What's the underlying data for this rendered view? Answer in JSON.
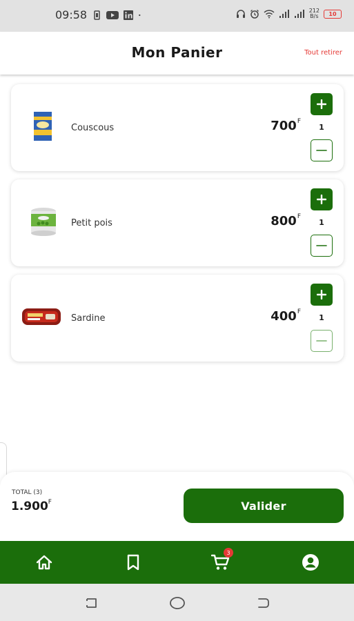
{
  "status_bar": {
    "time": "09:58",
    "net_speed_value": "212",
    "net_speed_unit": "B/s",
    "battery": "10"
  },
  "header": {
    "title": "Mon Panier",
    "remove_all": "Tout retirer"
  },
  "cart_items": [
    {
      "name": "Couscous",
      "price": "700",
      "currency": "F",
      "quantity": "1"
    },
    {
      "name": "Petit pois",
      "price": "800",
      "currency": "F",
      "quantity": "1"
    },
    {
      "name": "Sardine",
      "price": "400",
      "currency": "F",
      "quantity": "1"
    }
  ],
  "checkout": {
    "total_label": "TOTAL (3)",
    "total_value": "1.900",
    "currency": "F",
    "validate_label": "Valider"
  },
  "bottom_nav": {
    "items": [
      "home-icon",
      "bookmark-icon",
      "cart-icon",
      "account-icon"
    ],
    "cart_badge": "3"
  },
  "colors": {
    "primary": "#1b6e0b",
    "danger": "#e53935"
  }
}
